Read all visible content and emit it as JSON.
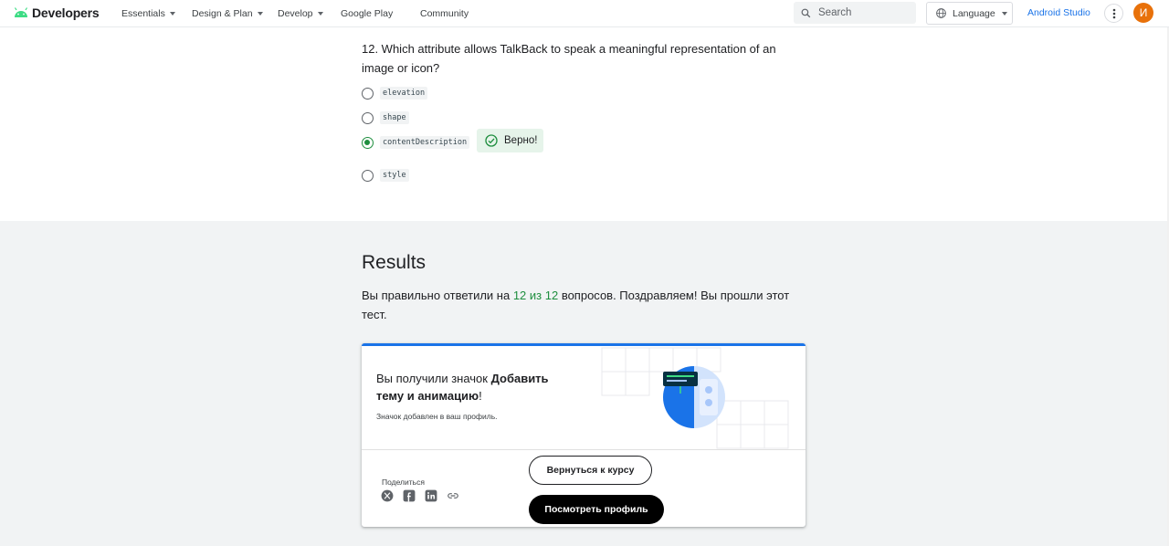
{
  "header": {
    "logo_text": "Developers",
    "nav": [
      {
        "label": "Essentials",
        "has_menu": true
      },
      {
        "label": "Design & Plan",
        "has_menu": true
      },
      {
        "label": "Develop",
        "has_menu": true
      },
      {
        "label": "Google Play",
        "has_menu": false
      },
      {
        "label": "Community",
        "has_menu": false
      }
    ],
    "search_placeholder": "Search",
    "language_label": "Language",
    "studio_link": "Android Studio",
    "avatar_initial": "И",
    "avatar_color": "#e8710a"
  },
  "question": {
    "text": "12. Which attribute allows TalkBack to speak a meaningful representation of an image or icon?",
    "options": [
      {
        "label": "elevation",
        "selected": false
      },
      {
        "label": "shape",
        "selected": false
      },
      {
        "label": "contentDescription",
        "selected": true
      },
      {
        "label": "style",
        "selected": false
      }
    ],
    "feedback": "Верно!"
  },
  "results": {
    "title": "Results",
    "text_before": "Вы правильно ответили на ",
    "score": "12 из 12",
    "text_after": " вопросов. Поздравляем! Вы прошли этот тест."
  },
  "badge_card": {
    "title_prefix": "Вы получили значок ",
    "title_bold": "Добавить тему и анимацию",
    "title_suffix": "!",
    "subtitle": "Значок добавлен в ваш профиль.",
    "share_label": "Поделиться",
    "share_icons": [
      "x-icon",
      "facebook-icon",
      "linkedin-icon",
      "link-icon"
    ],
    "back_button": "Вернуться к курсу",
    "profile_button": "Посмотреть профиль",
    "accent_color": "#1a73e8"
  },
  "colors": {
    "correct_green": "#1e8e3e",
    "correct_bg": "#e6f4ea",
    "results_bg": "#f1f3f4"
  }
}
